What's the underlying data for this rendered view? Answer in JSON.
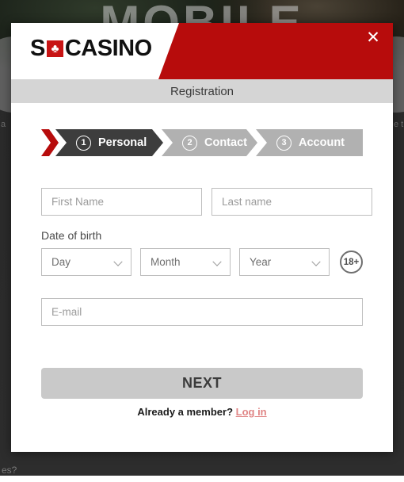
{
  "background": {
    "hero_text": "MOBILE",
    "side_text_left": "a",
    "side_text_right": "e t",
    "bottom_text": "es?"
  },
  "modal": {
    "brand": {
      "prefix": "S",
      "club_icon": "♣",
      "suffix": "CASINO"
    },
    "close_label": "✕",
    "title": "Registration",
    "stepper": {
      "steps": [
        {
          "number": "1",
          "label": "Personal",
          "state": "active"
        },
        {
          "number": "2",
          "label": "Contact",
          "state": "inactive"
        },
        {
          "number": "3",
          "label": "Account",
          "state": "inactive"
        }
      ]
    },
    "form": {
      "first_name_placeholder": "First Name",
      "first_name_value": "",
      "last_name_placeholder": "Last name",
      "last_name_value": "",
      "dob_label": "Date of birth",
      "day_value": "Day",
      "month_value": "Month",
      "year_value": "Year",
      "age_badge": "18+",
      "email_placeholder": "E-mail",
      "email_value": ""
    },
    "footer": {
      "next_label": "NEXT",
      "member_prompt": "Already a member? ",
      "login_label": "Log in"
    }
  },
  "colors": {
    "brand_red": "#B70C0C",
    "logo_red": "#C81414",
    "step_active": "#3D3D3D",
    "step_inactive": "#B1B1B1",
    "title_bar": "#D5D5D5",
    "next_button": "#C9C9C9",
    "link": "#E08585"
  }
}
